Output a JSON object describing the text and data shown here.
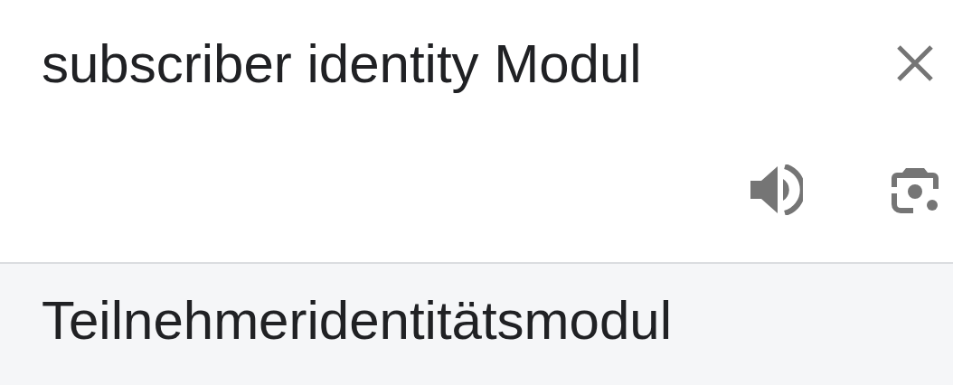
{
  "source": {
    "value": "subscriber identity Modul"
  },
  "translation": {
    "text": "Teilnehmeridentitätsmodul"
  }
}
